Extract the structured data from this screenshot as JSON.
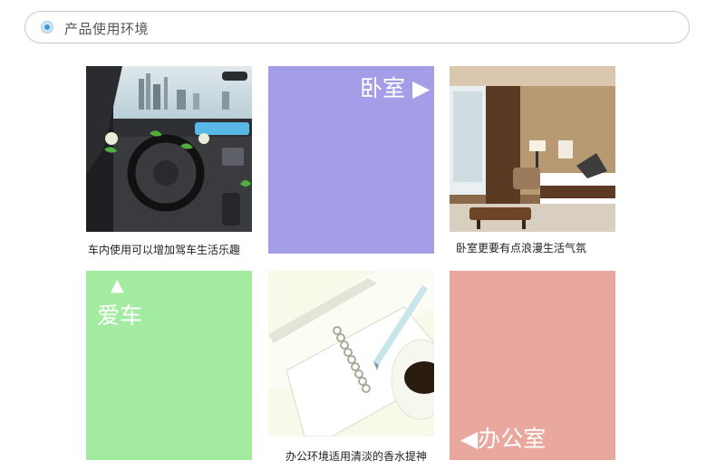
{
  "header": {
    "title": "产品使用环境",
    "icon": "target-icon"
  },
  "tiles": {
    "bedroom": {
      "label": "卧室 ▶",
      "color": "#a49de8"
    },
    "car": {
      "arrow": "▲",
      "label": "爱车",
      "color": "#a3eba1"
    },
    "office": {
      "label": "◀办公室",
      "color": "#e8a89e"
    }
  },
  "photos": {
    "car_interior": {
      "caption": "车内使用可以增加驾车生活乐趣"
    },
    "hotel_room": {
      "caption": "卧室更要有点浪漫生活气氛"
    },
    "office_desk": {
      "caption": "办公环境适用清淡的香水提神"
    }
  }
}
